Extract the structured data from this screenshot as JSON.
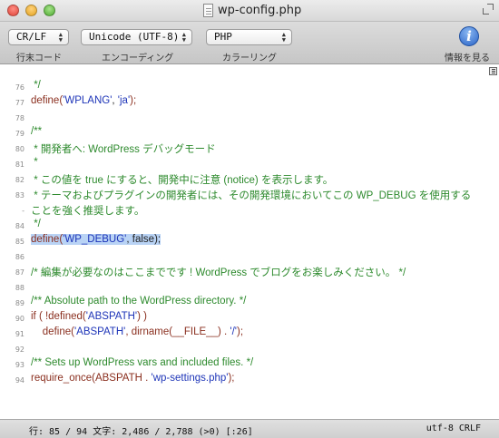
{
  "window": {
    "title": "wp-config.php"
  },
  "toolbar": {
    "line_ending": {
      "value": "CR/LF",
      "label": "行末コード"
    },
    "encoding": {
      "value": "Unicode (UTF-8)",
      "label": "エンコーディング"
    },
    "syntax": {
      "value": "PHP",
      "label": "カラーリング"
    },
    "info": {
      "label": "情報を見る"
    }
  },
  "editor": {
    "lines": [
      {
        "n": "76",
        "t": " */"
      },
      {
        "n": "77",
        "k1": "define(",
        "s1": "'WPLANG'",
        "p1": ", ",
        "s2": "'ja'",
        "k2": ");"
      },
      {
        "n": "78",
        "t": ""
      },
      {
        "n": "79",
        "t": "/**"
      },
      {
        "n": "80",
        "t": " * 開発者へ: WordPress デバッグモード"
      },
      {
        "n": "81",
        "t": " *"
      },
      {
        "n": "82",
        "t": " * この値を true にすると、開発中に注意 (notice) を表示します。"
      },
      {
        "n": "83",
        "t": " * テーマおよびプラグインの開発者には、その開発環境においてこの WP_DEBUG を使用する"
      },
      {
        "n": "-",
        "t": "ことを強く推奨します。"
      },
      {
        "n": "84",
        "t": " */"
      },
      {
        "n": "85",
        "k1": "define(",
        "s1": "'WP_DEBUG'",
        "p1": ", false);"
      },
      {
        "n": "86",
        "t": ""
      },
      {
        "n": "87",
        "t": "/* 編集が必要なのはここまでです ! WordPress でブログをお楽しみください。 */"
      },
      {
        "n": "88",
        "t": ""
      },
      {
        "n": "89",
        "t": "/** Absolute path to the WordPress directory. */"
      },
      {
        "n": "90",
        "k1": "if ( !defined(",
        "s1": "'ABSPATH'",
        "k2": ") )"
      },
      {
        "n": "91",
        "k1": "    define(",
        "s1": "'ABSPATH'",
        "p1": ", dirname(__FILE__) . ",
        "s2": "'/'",
        "k2": ");"
      },
      {
        "n": "92",
        "t": ""
      },
      {
        "n": "93",
        "t": "/** Sets up WordPress vars and included files. */"
      },
      {
        "n": "94",
        "k1": "require_once(",
        "p1": "ABSPATH . ",
        "s1": "'wp-settings.php'",
        "k2": ");"
      }
    ]
  },
  "status": {
    "position": "行: 85 / 94  文字: 2,486 / 2,788 (>0) [:26]",
    "encoding": "utf-8 CRLF"
  },
  "colors": {
    "comment": "#2d8a2d",
    "keyword": "#8a2f1f",
    "string": "#1e35b8",
    "selection": "#b9d3f5"
  }
}
